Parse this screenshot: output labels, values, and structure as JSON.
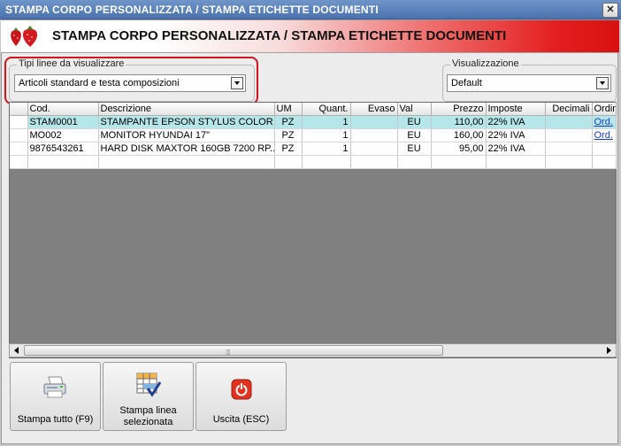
{
  "window": {
    "title": "STAMPA CORPO PERSONALIZZATA / STAMPA ETICHETTE DOCUMENTI",
    "close_label": "✕"
  },
  "header": {
    "title": "STAMPA CORPO PERSONALIZZATA / STAMPA ETICHETTE DOCUMENTI",
    "logo_icon": "strawberry-logo-icon",
    "colors": {
      "gradient_end": "#d81010"
    }
  },
  "filters": {
    "line_types": {
      "legend": "Tipi linee da visualizzare",
      "value": "Articoli standard e testa composizioni"
    },
    "view": {
      "legend": "Visualizzazione",
      "value": "Default"
    }
  },
  "grid": {
    "columns": [
      "",
      "Cod.",
      "Descrizione",
      "UM",
      "Quant.",
      "Evaso",
      "Val",
      "Prezzo",
      "Imposte",
      "Decimali",
      "Ordin"
    ],
    "rows": [
      {
        "cod": "STAM0001",
        "descrizione": "STAMPANTE EPSON STYLUS COLOR C...",
        "um": "PZ",
        "quant": "1",
        "evaso": "",
        "val": "EU",
        "prezzo": "110,00",
        "imposte": "22% IVA",
        "decimali": "",
        "ordine": "Ord."
      },
      {
        "cod": "MO002",
        "descrizione": "MONITOR HYUNDAI 17\"",
        "um": "PZ",
        "quant": "1",
        "evaso": "",
        "val": "EU",
        "prezzo": "160,00",
        "imposte": "22% IVA",
        "decimali": "",
        "ordine": "Ord."
      },
      {
        "cod": "9876543261",
        "descrizione": "HARD DISK MAXTOR 160GB 7200 RP...",
        "um": "PZ",
        "quant": "1",
        "evaso": "",
        "val": "EU",
        "prezzo": "95,00",
        "imposte": "22% IVA",
        "decimali": "",
        "ordine": ""
      }
    ],
    "selected_row_color": "#b4e6ea"
  },
  "buttons": {
    "print_all": {
      "label": "Stampa tutto (F9)",
      "icon": "printer-icon"
    },
    "print_selected": {
      "label_line1": "Stampa linea",
      "label_line2": "selezionata",
      "icon": "checked-grid-icon"
    },
    "exit": {
      "label": "Uscita (ESC)",
      "icon": "power-exit-icon"
    }
  },
  "accent_colors": {
    "highlight_ring": "#d2141b",
    "link": "#1a3cc2"
  }
}
